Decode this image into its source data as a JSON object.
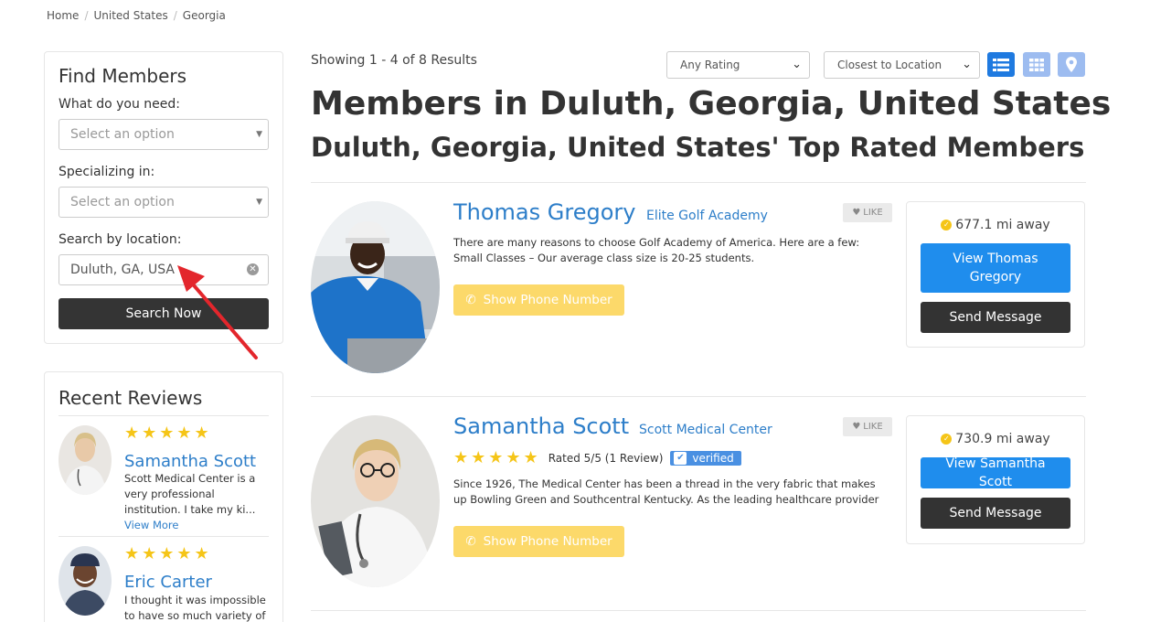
{
  "breadcrumb": [
    "Home",
    "United States",
    "Georgia"
  ],
  "sidebar": {
    "find_title": "Find Members",
    "need_label": "What do you need:",
    "need_placeholder": "Select an option",
    "specializing_label": "Specializing in:",
    "specializing_placeholder": "Select an option",
    "location_label": "Search by location:",
    "location_value": "Duluth, GA, USA",
    "search_button": "Search Now"
  },
  "reviews": {
    "title": "Recent Reviews",
    "items": [
      {
        "stars": "★★★★★",
        "name": "Samantha Scott",
        "text": "Scott Medical Center is a very professional institution. I take my ki...",
        "more": "View More"
      },
      {
        "stars": "★★★★★",
        "name": "Eric Carter",
        "text": "I thought it was impossible to have so much variety of"
      }
    ]
  },
  "results": {
    "showing": "Showing 1 - 4 of 8 Results",
    "rating_filter": "Any Rating",
    "sort_filter": "Closest to Location",
    "title": "Members in Duluth, Georgia, United States",
    "subtitle": "Duluth, Georgia, United States' Top Rated Members"
  },
  "members": [
    {
      "name": "Thomas Gregory",
      "company": "Elite Golf Academy",
      "like": "LIKE",
      "description": "There are many reasons to choose Golf Academy of America. Here are a few: Small Classes –   Our average class size is 20-25 students.",
      "phone_button": "Show Phone Number",
      "distance": "677.1 mi away",
      "view_button": "View Thomas Gregory",
      "message_button": "Send Message"
    },
    {
      "name": "Samantha Scott",
      "company": "Scott Medical Center",
      "like": "LIKE",
      "stars": "★★★★★",
      "rating": "Rated 5/5 (1 Review)",
      "verified": "verified",
      "description": "Since 1926, The Medical Center has been a thread in the very fabric that makes up Bowling Green and Southcentral Kentucky. As the leading healthcare provider",
      "phone_button": "Show Phone Number",
      "distance": "730.9 mi away",
      "view_button": "View Samantha Scott",
      "message_button": "Send Message"
    }
  ],
  "colors": {
    "link_blue": "#2d7ec9",
    "primary_button": "#1f8ded",
    "phone_button": "#fcd96a",
    "dark_button": "#333333",
    "star_yellow": "#f5c518",
    "annotation_arrow": "#e3262c"
  }
}
